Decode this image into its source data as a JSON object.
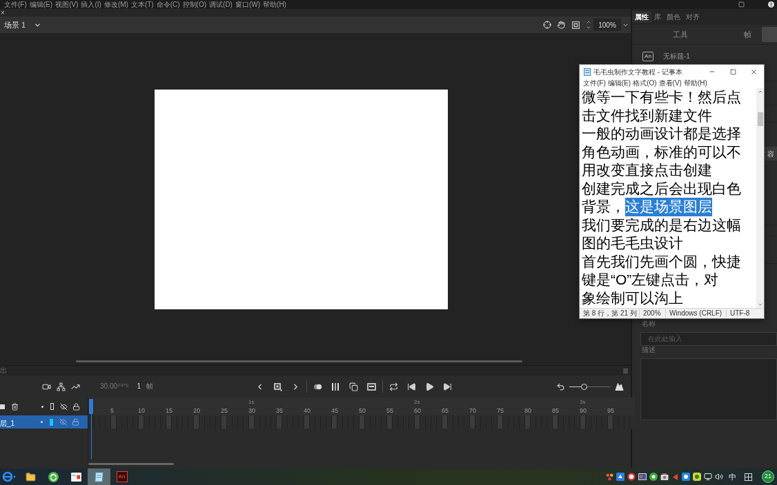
{
  "menu_bar": {
    "items": [
      "文件(F)",
      "编辑(E)",
      "视图(V)",
      "插入(I)",
      "修改(M)",
      "文本(T)",
      "命令(C)",
      "控制(O)",
      "调试(D)",
      "窗口(W)",
      "帮助(H)"
    ]
  },
  "document_tabs": {
    "close": "×"
  },
  "scene_bar": {
    "scene": "场景 1",
    "zoom": "100%"
  },
  "timeline": {
    "panel_tab": "出",
    "fps": "30.00",
    "fps_unit": "FPS",
    "frame": "1",
    "frame_unit": "帧",
    "seconds": [
      "1s",
      "2s",
      "3s"
    ],
    "frame_numbers": [
      "5",
      "10",
      "15",
      "20",
      "25",
      "30",
      "35",
      "40",
      "45",
      "50",
      "55",
      "60",
      "65",
      "70",
      "75",
      "80",
      "85",
      "90",
      "95"
    ],
    "layers": [
      {
        "name": "层_1",
        "selected": true
      }
    ],
    "zoom_slider": {
      "level": 0.35
    }
  },
  "properties_panel": {
    "tabs": [
      {
        "label": "属性",
        "selected": true
      },
      {
        "label": "库",
        "selected": false
      },
      {
        "label": "颜色",
        "selected": false
      },
      {
        "label": "对齐",
        "selected": false
      }
    ],
    "subtabs": [
      {
        "label": "工具",
        "selected": false
      },
      {
        "label": "帧",
        "selected": false
      }
    ],
    "document": {
      "icon": "An",
      "name": "无标题-1"
    },
    "cut_button": "容",
    "name_field": {
      "label": "名称",
      "placeholder": "在此处输入"
    },
    "description_field": {
      "label": "描述"
    }
  },
  "notepad": {
    "title": "毛毛虫制作文字教程 - 记事本",
    "menu": [
      "文件(F)",
      "编辑(E)",
      "格式(O)",
      "查看(V)",
      "帮助(H)"
    ],
    "lines": [
      {
        "segments": [
          {
            "text": "微等一下有些卡！然后点",
            "selected": false
          }
        ]
      },
      {
        "segments": [
          {
            "text": "击文件找到新建文件",
            "selected": false
          }
        ]
      },
      {
        "segments": [
          {
            "text": "一般的动画设计都是选择",
            "selected": false
          }
        ]
      },
      {
        "segments": [
          {
            "text": "角色动画，标准的可以不",
            "selected": false
          }
        ]
      },
      {
        "segments": [
          {
            "text": "用改变直接点击创建",
            "selected": false
          }
        ]
      },
      {
        "segments": [
          {
            "text": "创建完成之后会出现白色",
            "selected": false
          }
        ]
      },
      {
        "segments": [
          {
            "text": "背景，",
            "selected": false
          },
          {
            "text": "这是场景图层",
            "selected": true
          }
        ]
      },
      {
        "segments": [
          {
            "text": "我们要完成的是右边这幅",
            "selected": false
          }
        ]
      },
      {
        "segments": [
          {
            "text": "图的毛毛虫设计",
            "selected": false
          }
        ]
      },
      {
        "segments": [
          {
            "text": "首先我们先画个圆，快捷",
            "selected": false
          }
        ]
      },
      {
        "segments": [
          {
            "text": "键是“O”左键点击，对",
            "selected": false
          }
        ]
      },
      {
        "segments": [
          {
            "text": "象绘制可以沟上",
            "selected": false
          }
        ]
      }
    ],
    "status": [
      "第 8 行，第 21 列",
      "200%",
      "Windows (CRLF)",
      "UTF-8"
    ]
  },
  "taskbar": {
    "apps": [
      {
        "kind": "browser",
        "selected": false
      },
      {
        "kind": "folder",
        "selected": false
      },
      {
        "kind": "green-app",
        "selected": false
      },
      {
        "kind": "media",
        "selected": false
      },
      {
        "kind": "notepad",
        "selected": true
      },
      {
        "kind": "animate",
        "label": "An",
        "selected": false
      }
    ],
    "ime": "中",
    "badge": "21"
  }
}
